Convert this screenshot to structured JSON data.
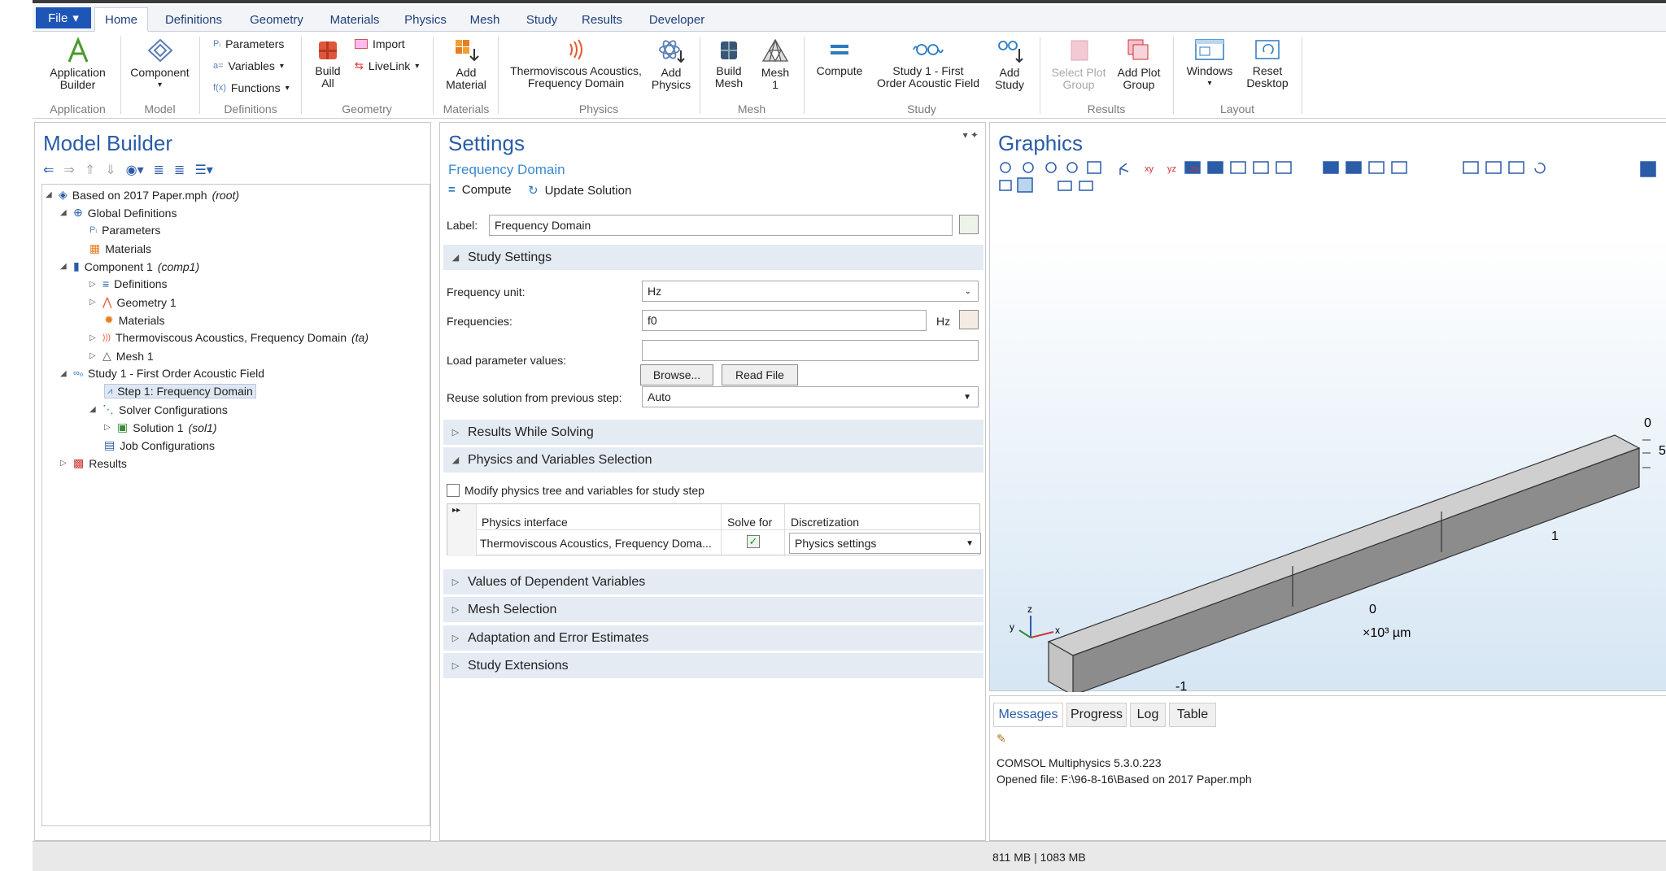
{
  "ribbon": {
    "file_label": "File",
    "tabs": [
      "Home",
      "Definitions",
      "Geometry",
      "Materials",
      "Physics",
      "Mesh",
      "Study",
      "Results",
      "Developer"
    ],
    "buttons": {
      "application_builder": "Application\nBuilder",
      "component": "Component",
      "parameters": "Parameters",
      "variables": "Variables",
      "functions": "Functions",
      "build_all": "Build\nAll",
      "import": "Import",
      "livelink": "LiveLink",
      "add_material": "Add\nMaterial",
      "thermoviscous": "Thermoviscous Acoustics,\nFrequency Domain",
      "add_physics": "Add\nPhysics",
      "build_mesh": "Build\nMesh",
      "mesh1": "Mesh\n1",
      "compute": "Compute",
      "study1": "Study 1 - First\nOrder Acoustic Field",
      "add_study": "Add\nStudy",
      "select_plot_group": "Select Plot\nGroup",
      "add_plot_group": "Add Plot\nGroup",
      "windows": "Windows",
      "reset_desktop": "Reset\nDesktop"
    },
    "groups": [
      "Application",
      "Model",
      "Definitions",
      "Geometry",
      "Materials",
      "Physics",
      "Mesh",
      "Study",
      "Results",
      "Layout"
    ]
  },
  "model_builder": {
    "title": "Model Builder",
    "tree": [
      {
        "label": "Based on 2017 Paper.mph",
        "suffix": "(root)"
      },
      {
        "label": "Global Definitions"
      },
      {
        "label": "Parameters"
      },
      {
        "label": "Materials"
      },
      {
        "label": "Component 1",
        "suffix": "(comp1)"
      },
      {
        "label": "Definitions"
      },
      {
        "label": "Geometry 1"
      },
      {
        "label": "Materials"
      },
      {
        "label": "Thermoviscous Acoustics, Frequency Domain",
        "suffix": "(ta)"
      },
      {
        "label": "Mesh 1"
      },
      {
        "label": "Study 1 - First Order Acoustic Field"
      },
      {
        "label": "Step 1: Frequency Domain"
      },
      {
        "label": "Solver Configurations"
      },
      {
        "label": "Solution 1",
        "suffix": "(sol1)"
      },
      {
        "label": "Job Configurations"
      },
      {
        "label": "Results"
      }
    ]
  },
  "settings": {
    "title": "Settings",
    "subtitle": "Frequency Domain",
    "compute": "Compute",
    "update_solution": "Update Solution",
    "label_caption": "Label:",
    "label_value": "Frequency Domain",
    "sections": [
      "Study Settings",
      "Results While Solving",
      "Physics and Variables Selection",
      "Values of Dependent Variables",
      "Mesh Selection",
      "Adaptation and Error Estimates",
      "Study Extensions"
    ],
    "frequency_unit_caption": "Frequency unit:",
    "frequency_unit_value": "Hz",
    "frequencies_caption": "Frequencies:",
    "frequencies_value": "f0",
    "frequencies_unit": "Hz",
    "load_param_caption": "Load parameter values:",
    "browse": "Browse...",
    "read_file": "Read File",
    "reuse_caption": "Reuse solution from previous step:",
    "reuse_value": "Auto",
    "modify_physics": "Modify physics tree and variables for study step",
    "table_headers": [
      "Physics interface",
      "Solve for",
      "Discretization"
    ],
    "table_row": {
      "interface": "Thermoviscous Acoustics, Frequency Doma...",
      "discretization": "Physics settings"
    }
  },
  "graphics": {
    "title": "Graphics",
    "axis_labels": {
      "a": "1",
      "b": "0",
      "c": "-1",
      "scale": "×10³ µm",
      "top_right_0": "0",
      "top_right_5": "5"
    },
    "triad": {
      "x": "x",
      "y": "y",
      "z": "z"
    }
  },
  "messages": {
    "tabs": [
      "Messages",
      "Progress",
      "Log",
      "Table"
    ],
    "lines": [
      "COMSOL Multiphysics 5.3.0.223",
      "Opened file: F:\\96-8-16\\Based on 2017 Paper.mph"
    ]
  },
  "status": {
    "memory": "811 MB | 1083 MB"
  }
}
